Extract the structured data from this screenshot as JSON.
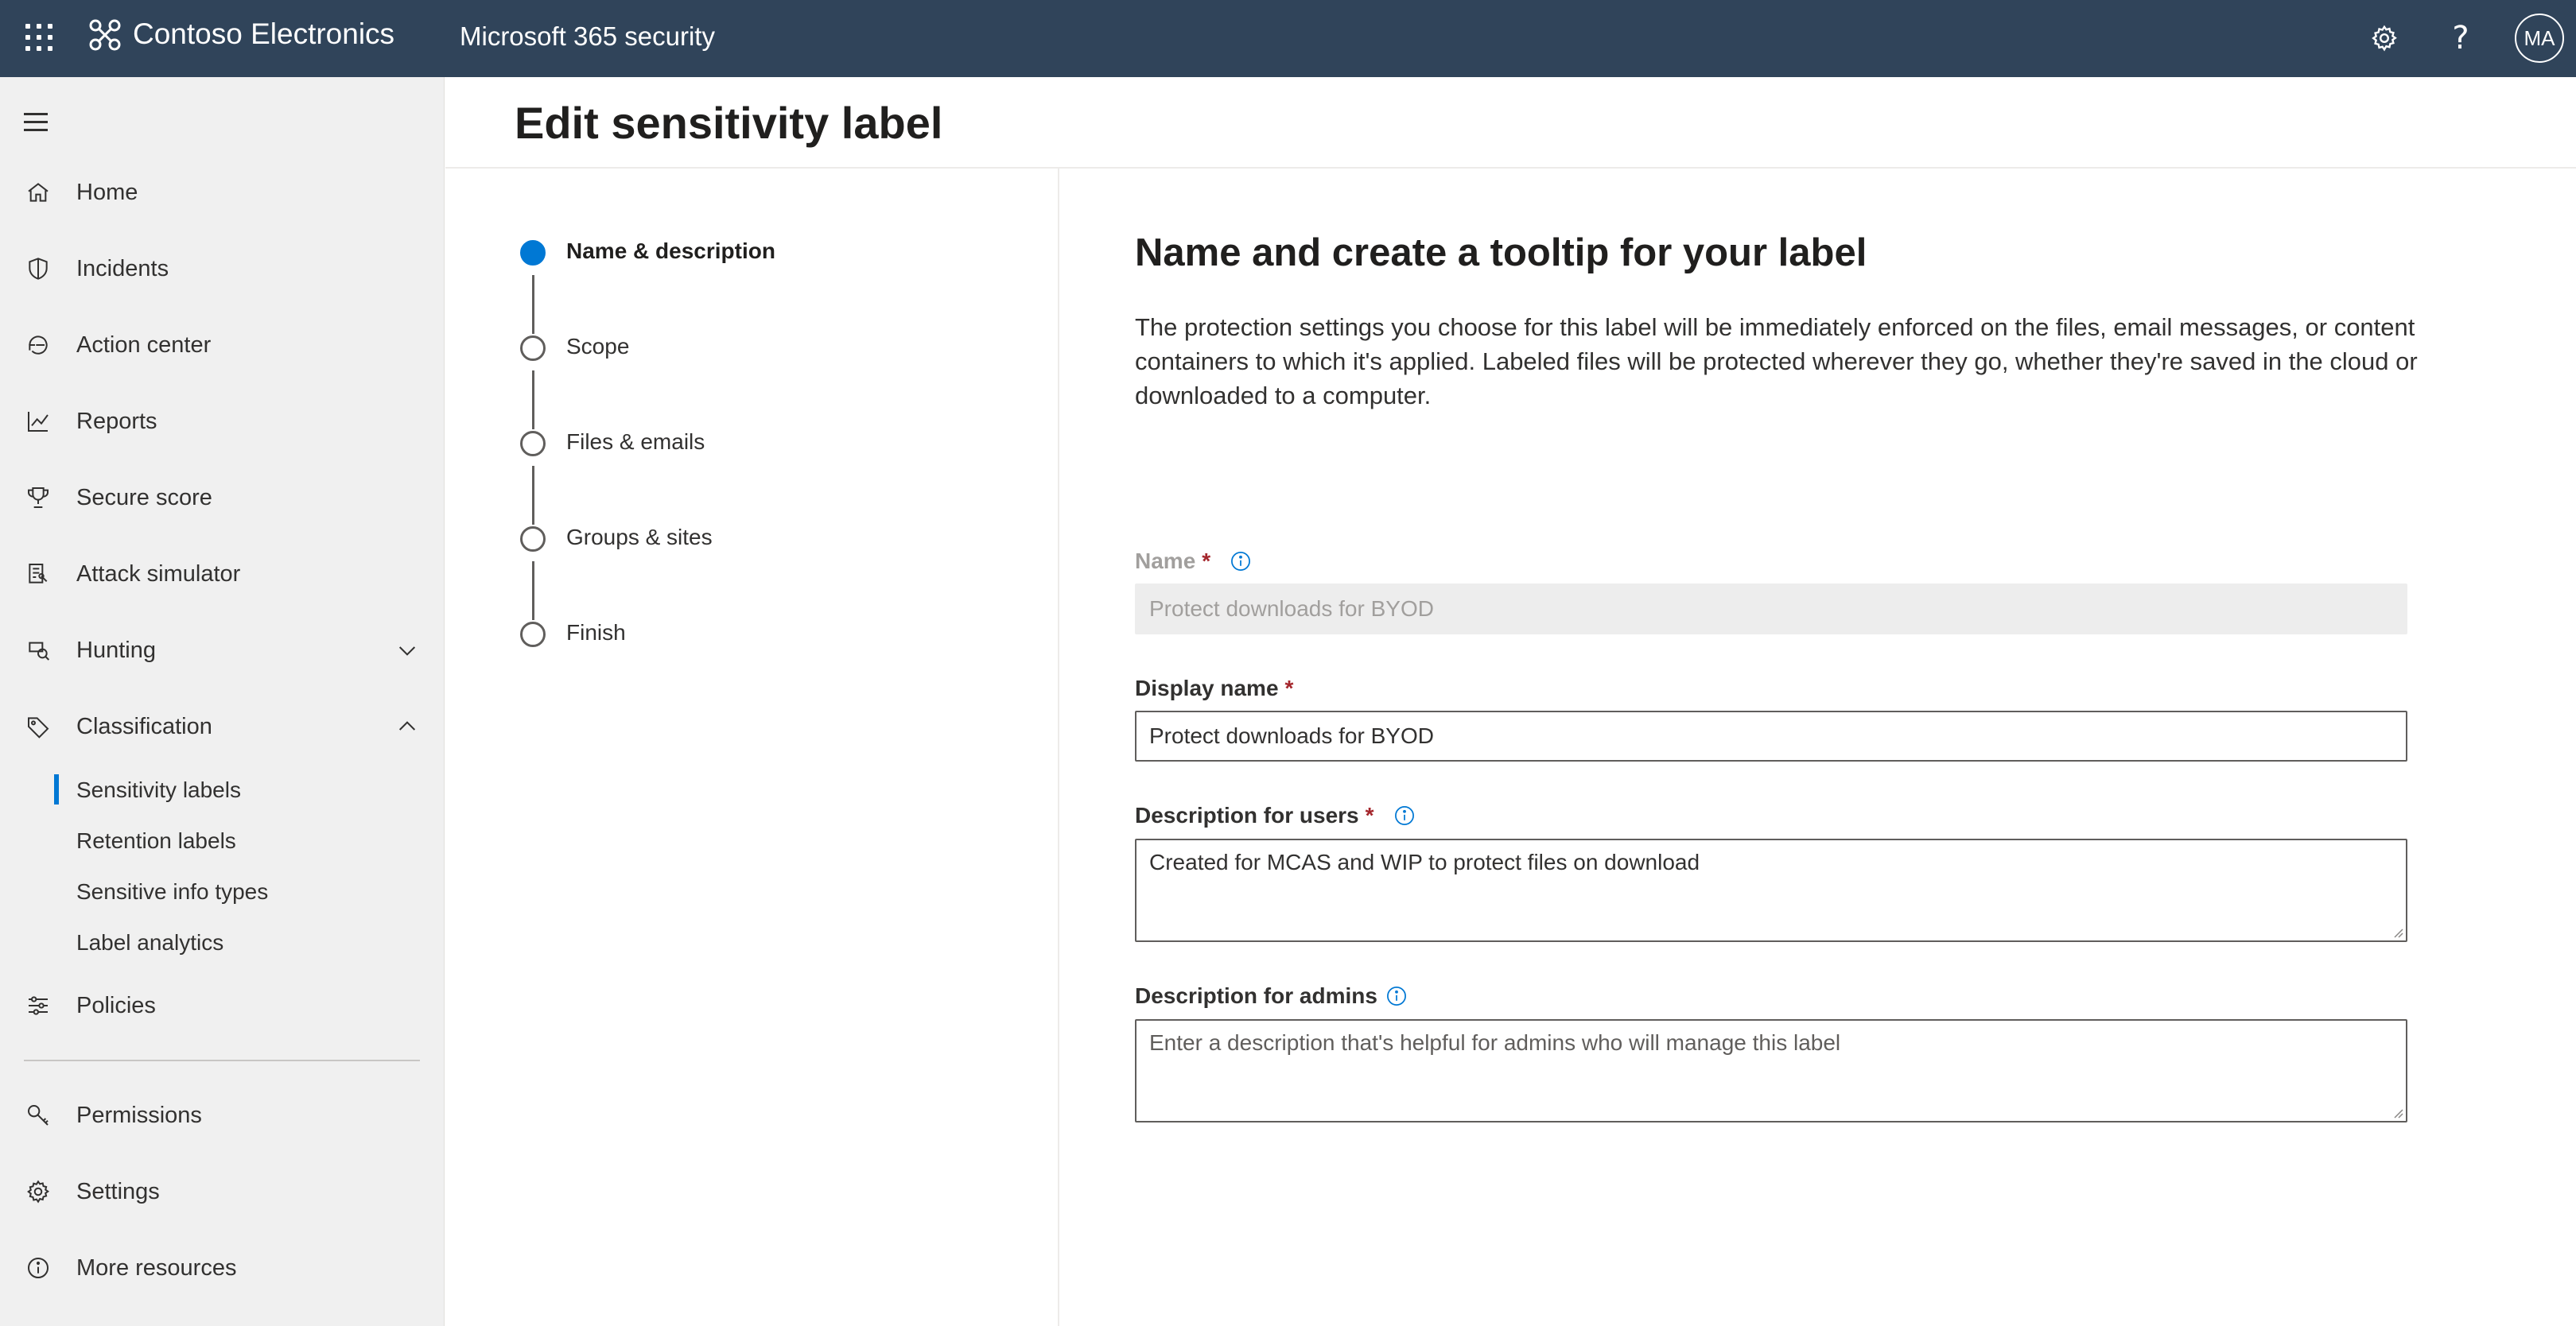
{
  "topbar": {
    "brand": "Contoso Electronics",
    "app": "Microsoft 365 security",
    "avatar_initials": "MA",
    "help_glyph": "?",
    "bg_color": "#30445a"
  },
  "sidebar": {
    "items": [
      {
        "label": "Home",
        "icon": "home-icon"
      },
      {
        "label": "Incidents",
        "icon": "shield-icon"
      },
      {
        "label": "Action center",
        "icon": "action-center-icon"
      },
      {
        "label": "Reports",
        "icon": "chart-line-icon"
      },
      {
        "label": "Secure score",
        "icon": "trophy-icon"
      },
      {
        "label": "Attack simulator",
        "icon": "attack-simulator-icon"
      },
      {
        "label": "Hunting",
        "icon": "hunting-icon",
        "expanded": false
      },
      {
        "label": "Classification",
        "icon": "tag-icon",
        "expanded": true
      },
      {
        "label": "Policies",
        "icon": "sliders-icon"
      },
      {
        "label": "Permissions",
        "icon": "key-icon"
      },
      {
        "label": "Settings",
        "icon": "gear-icon"
      },
      {
        "label": "More resources",
        "icon": "info-icon"
      }
    ],
    "classification_sub": [
      {
        "label": "Sensitivity labels",
        "active": true
      },
      {
        "label": "Retention labels",
        "active": false
      },
      {
        "label": "Sensitive info types",
        "active": false
      },
      {
        "label": "Label analytics",
        "active": false
      }
    ]
  },
  "page": {
    "title": "Edit sensitivity label"
  },
  "wizard": {
    "steps": [
      {
        "label": "Name & description",
        "current": true
      },
      {
        "label": "Scope",
        "current": false
      },
      {
        "label": "Files & emails",
        "current": false
      },
      {
        "label": "Groups & sites",
        "current": false
      },
      {
        "label": "Finish",
        "current": false
      }
    ]
  },
  "content": {
    "title": "Name and create a tooltip for your label",
    "description": "The protection settings you choose for this label will be immediately enforced on the files, email messages, or content containers to which it's applied. Labeled files will be protected wherever they go, whether they're saved in the cloud or downloaded to a computer.",
    "fields": {
      "name": {
        "label": "Name",
        "required": "*",
        "value": "Protect downloads for BYOD",
        "disabled": true
      },
      "display_name": {
        "label": "Display name",
        "required": "*",
        "value": "Protect downloads for BYOD"
      },
      "desc_users": {
        "label": "Description for users",
        "required": "*",
        "value": "Created for MCAS and WIP to protect files on download"
      },
      "desc_admins": {
        "label": "Description for admins",
        "placeholder": "Enter a description that's helpful for admins who will manage this label"
      }
    }
  },
  "colors": {
    "accent": "#0078d4",
    "required": "#a4262c",
    "info": "#0078d4"
  }
}
